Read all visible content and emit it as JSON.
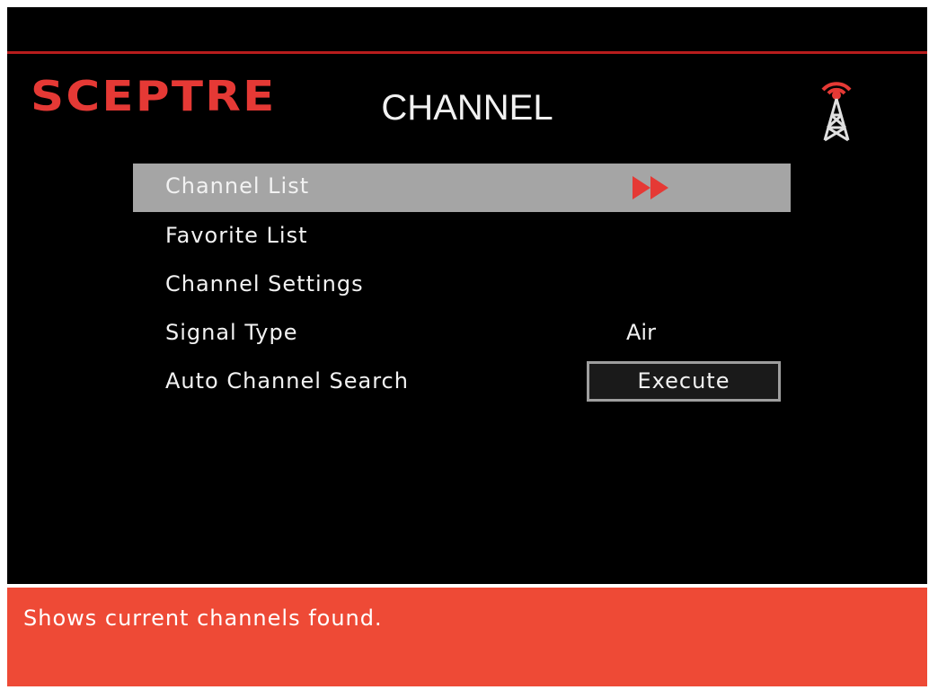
{
  "brand": {
    "logo_text": "SCEPTRE",
    "logo_color": "#e53935"
  },
  "header": {
    "title": "CHANNEL",
    "icon": "antenna-tower-icon"
  },
  "menu": {
    "items": [
      {
        "label": "Channel List",
        "selected": true,
        "icon": "double-arrow-right-icon"
      },
      {
        "label": "Favorite List"
      },
      {
        "label": "Channel Settings"
      },
      {
        "label": "Signal Type",
        "value": "Air"
      },
      {
        "label": "Auto Channel Search",
        "button_label": "Execute"
      }
    ]
  },
  "help": {
    "text": "Shows current channels found."
  },
  "colors": {
    "background": "#000000",
    "selection": "#a5a5a5",
    "accent_red": "#e53935",
    "help_bar": "#ee4a36",
    "text": "#f2f2f2"
  }
}
